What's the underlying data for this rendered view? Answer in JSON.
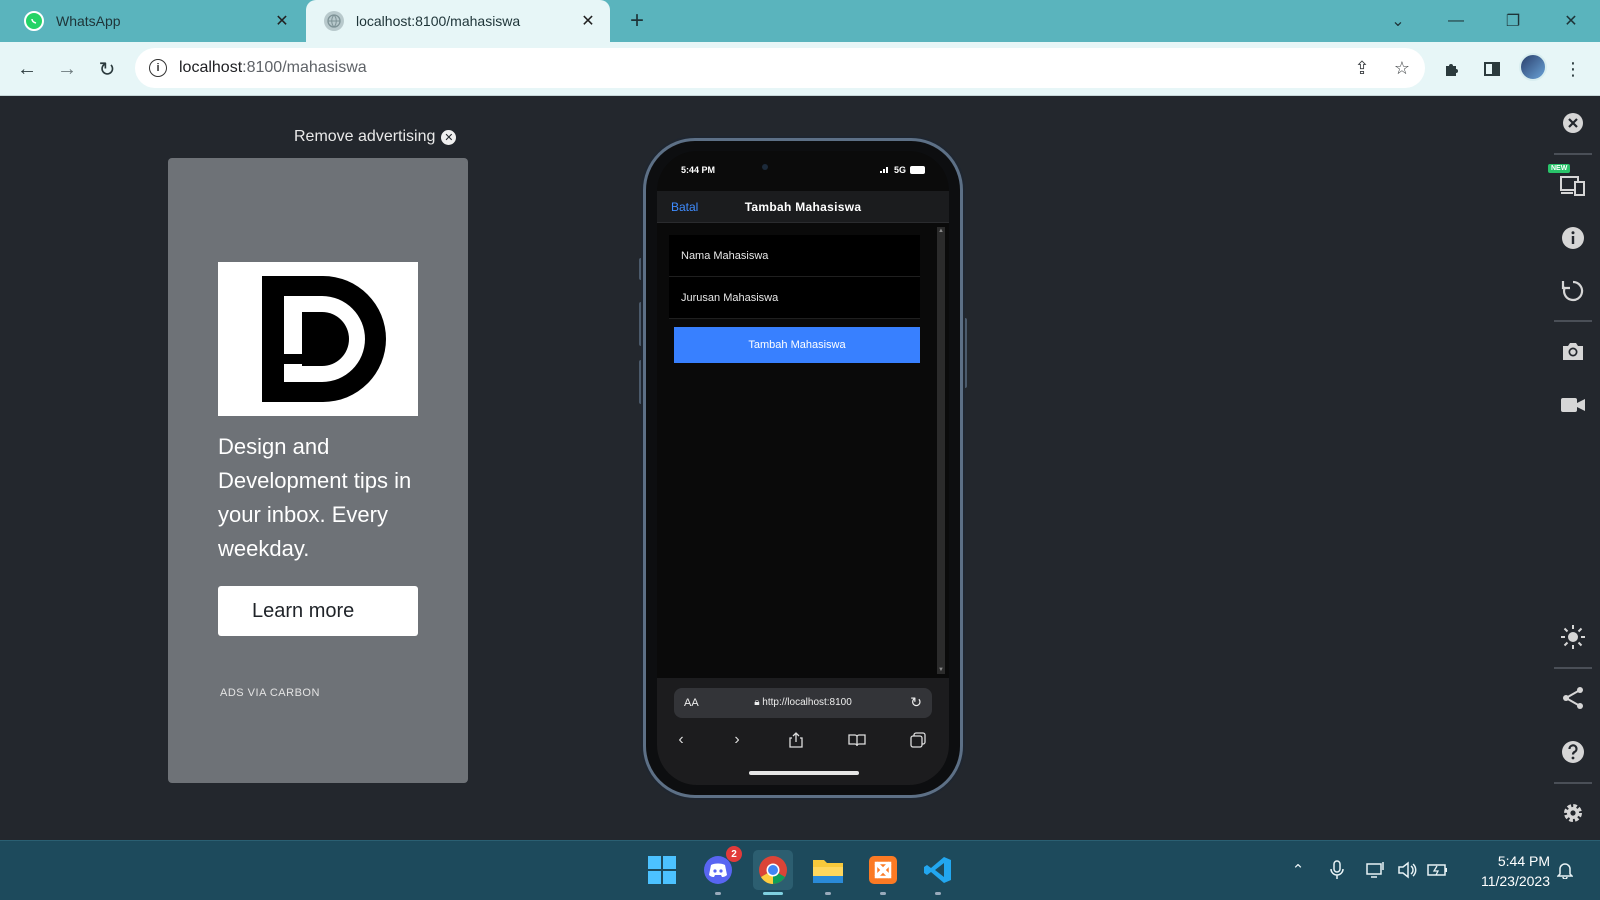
{
  "browser": {
    "tabs": [
      {
        "title": "WhatsApp",
        "icon": "whatsapp-icon",
        "active": false
      },
      {
        "title": "localhost:8100/mahasiswa",
        "icon": "globe-icon",
        "active": true
      }
    ],
    "address": {
      "host": "localhost",
      "path": ":8100/mahasiswa"
    }
  },
  "ad": {
    "remove_label": "Remove advertising",
    "logo_letter": "D",
    "text": "Design and Development tips in your inbox. Every weekday.",
    "button_label": "Learn more",
    "via_label": "ADS VIA CARBON"
  },
  "phone": {
    "status_time": "5:44 PM",
    "network": "5G",
    "header": {
      "cancel_label": "Batal",
      "title": "Tambah Mahasiswa"
    },
    "form": {
      "name_placeholder": "Nama Mahasiswa",
      "major_placeholder": "Jurusan Mahasiswa",
      "submit_label": "Tambah Mahasiswa"
    },
    "safari": {
      "text_size_label": "AA",
      "url": "http://localhost:8100"
    }
  },
  "rail": {
    "new_badge": "NEW"
  },
  "taskbar": {
    "discord_badge": "2",
    "time": "5:44 PM",
    "date": "11/23/2023"
  },
  "colors": {
    "chrome_tab_bar": "#5ab4bd",
    "devtools_bg": "#23272d",
    "ionic_primary": "#3880ff",
    "taskbar": "#1d4a5c"
  }
}
